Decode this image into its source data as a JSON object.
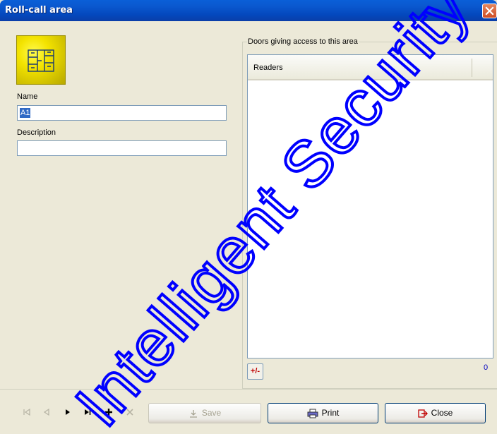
{
  "window": {
    "title": "Roll-call area"
  },
  "form": {
    "name_label": "Name",
    "name_value": "A1",
    "description_label": "Description",
    "description_value": ""
  },
  "doors": {
    "group_label": "Doors giving access to this area",
    "column_header": "Readers",
    "add_remove_label": "+/-",
    "count": "0"
  },
  "buttons": {
    "save_label": "Save",
    "print_label": "Print",
    "close_label": "Close"
  },
  "watermark": {
    "text": "Intelligent Security &",
    "color": "#0000ff"
  },
  "icons": {
    "first": "first-record-icon",
    "prev": "previous-record-icon",
    "next": "next-record-icon",
    "last": "last-record-icon",
    "add": "add-record-icon",
    "delete": "delete-record-icon"
  }
}
